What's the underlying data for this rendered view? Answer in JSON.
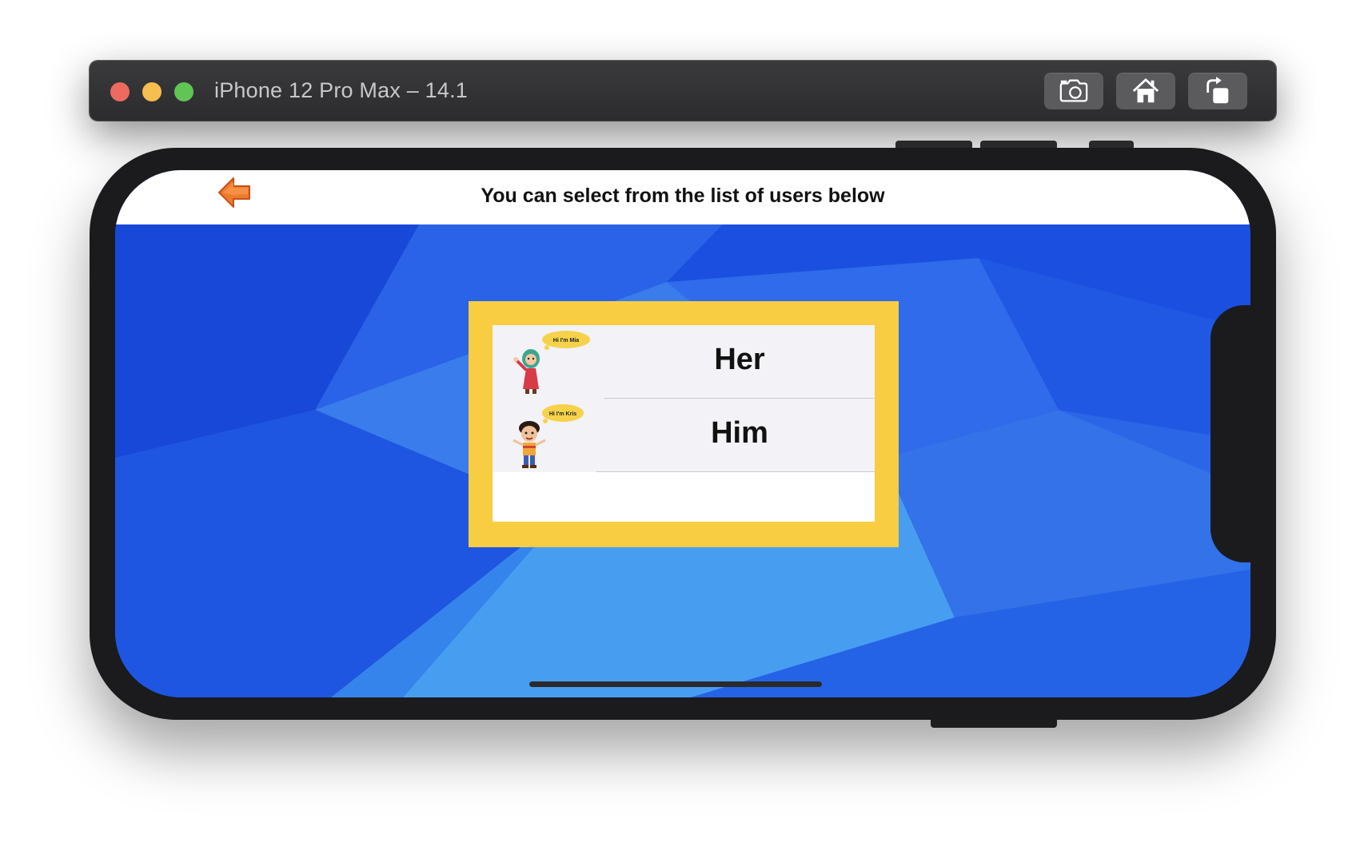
{
  "window": {
    "title": "iPhone 12 Pro Max – 14.1",
    "toolbar": [
      {
        "name": "screenshot",
        "icon": "camera-icon"
      },
      {
        "name": "home",
        "icon": "home-icon"
      },
      {
        "name": "rotate",
        "icon": "rotate-icon"
      }
    ]
  },
  "app": {
    "nav": {
      "back_icon": "back-arrow-icon",
      "title": "You can select from the list of users below"
    },
    "users": [
      {
        "label": "Her",
        "bubble": "Hi I'm Mia",
        "avatar": "girl-avatar-icon"
      },
      {
        "label": "Him",
        "bubble": "Hi I'm Kris",
        "avatar": "boy-avatar-icon"
      }
    ]
  },
  "colors": {
    "panel_border": "#f8cd41",
    "background_blue": "#1c4fe0",
    "back_arrow": "#f07a2c"
  }
}
